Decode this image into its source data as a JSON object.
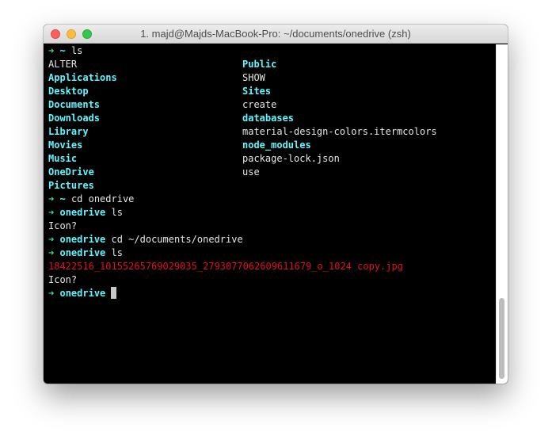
{
  "window": {
    "title": "1. majd@Majds-MacBook-Pro: ~/documents/onedrive (zsh)"
  },
  "colors": {
    "directory": "#5ff6ff",
    "prompt_arrow": "#39e08e",
    "plain": "#e6e6e6",
    "special_file": "#e0101e",
    "background": "#000000"
  },
  "icons": {
    "close": "close-icon",
    "minimize": "minimize-icon",
    "maximize": "maximize-icon",
    "prompt": "arrow-right-icon"
  },
  "terminal": {
    "prompt_symbol": "➜",
    "prompt1": {
      "cwd": "~",
      "command": "ls"
    },
    "listing1": [
      {
        "left": "ALTER",
        "right": "Public"
      },
      {
        "left": "Applications",
        "right": "SHOW"
      },
      {
        "left": "Desktop",
        "right": "Sites"
      },
      {
        "left": "Documents",
        "right": "create"
      },
      {
        "left": "Downloads",
        "right": "databases"
      },
      {
        "left": "Library",
        "right": "material-design-colors.itermcolors"
      },
      {
        "left": "Movies",
        "right": "node_modules"
      },
      {
        "left": "Music",
        "right": "package-lock.json"
      },
      {
        "left": "OneDrive",
        "right": "use"
      },
      {
        "left": "Pictures",
        "right": ""
      }
    ],
    "prompt2": {
      "cwd": "~",
      "command": "cd onedrive"
    },
    "prompt3": {
      "cwd": "onedrive",
      "command": "ls"
    },
    "output3": "Icon?",
    "prompt4": {
      "cwd": "onedrive",
      "command": "cd ~/documents/onedrive"
    },
    "prompt5": {
      "cwd": "onedrive",
      "command": "ls"
    },
    "output5_file": "18422516_10155265769029035_2793077062609611679_o_1024 copy.jpg",
    "output5_icon": "Icon?",
    "prompt6": {
      "cwd": "onedrive",
      "command": ""
    }
  }
}
